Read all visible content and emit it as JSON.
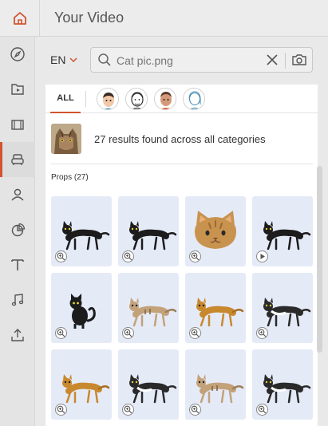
{
  "header": {
    "title": "Your Video"
  },
  "rail": {
    "items": [
      {
        "name": "explore-icon"
      },
      {
        "name": "media-icon"
      },
      {
        "name": "scene-icon"
      },
      {
        "name": "props-icon",
        "active": true
      },
      {
        "name": "character-icon"
      },
      {
        "name": "chart-icon"
      },
      {
        "name": "text-icon"
      },
      {
        "name": "music-icon"
      },
      {
        "name": "upload-icon"
      }
    ]
  },
  "search": {
    "language": "EN",
    "placeholder": "Cat pic.png"
  },
  "tabs": {
    "all_label": "ALL",
    "avatars": [
      "avatar-man-icon",
      "avatar-outline-icon",
      "avatar-bald-icon",
      "avatar-woman-icon"
    ]
  },
  "results": {
    "summary": "27 results found across all categories",
    "section_title": "Props (27)"
  },
  "items": [
    {
      "kind": "black-cat",
      "badge": "zoom-icon"
    },
    {
      "kind": "black-cat",
      "badge": "zoom-icon"
    },
    {
      "kind": "cat-face",
      "badge": "zoom-icon"
    },
    {
      "kind": "black-cat",
      "badge": "play-icon"
    },
    {
      "kind": "black-cat-sitting",
      "badge": "zoom-icon"
    },
    {
      "kind": "tabby-cat",
      "badge": "zoom-icon"
    },
    {
      "kind": "orange-cat",
      "badge": "zoom-icon"
    },
    {
      "kind": "bw-cat",
      "badge": "zoom-icon"
    },
    {
      "kind": "orange-cat",
      "badge": "zoom-icon"
    },
    {
      "kind": "bw-cat",
      "badge": "zoom-icon"
    },
    {
      "kind": "tabby-cat",
      "badge": "zoom-icon"
    },
    {
      "kind": "bw-cat",
      "badge": "zoom-icon"
    }
  ],
  "colors": {
    "accent": "#d2532f",
    "card_bg": "#e5eaf7"
  }
}
